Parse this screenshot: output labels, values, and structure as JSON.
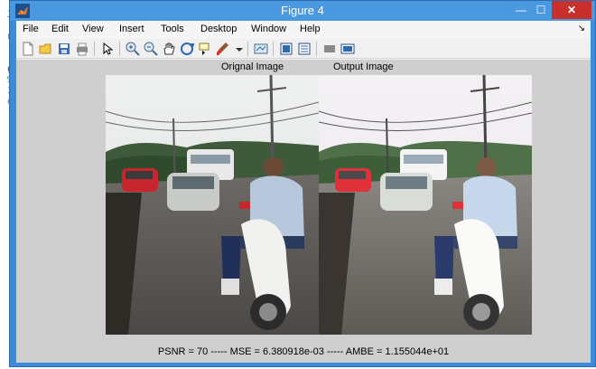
{
  "window": {
    "title": "Figure 4",
    "close_glyph": "✕",
    "minimize_glyph": "—",
    "maximize_glyph": "☐"
  },
  "menu": {
    "items": [
      "File",
      "Edit",
      "View",
      "Insert",
      "Tools",
      "Desktop",
      "Window",
      "Help"
    ],
    "dock_glyph": "↘"
  },
  "toolbar": {
    "icons": [
      "new-figure-icon",
      "open-file-icon",
      "save-icon",
      "print-icon",
      "edit-plot-icon",
      "zoom-in-icon",
      "zoom-out-icon",
      "pan-icon",
      "rotate-3d-icon",
      "data-cursor-icon",
      "brush-icon",
      "link-plot-icon",
      "insert-colorbar-icon",
      "insert-legend-icon",
      "hide-plot-tools-icon",
      "show-plot-tools-icon"
    ]
  },
  "figure": {
    "left_title": "Orignal Image",
    "right_title": "Output Image",
    "caption": "PSNR = 70 ----- MSE  = 6.380918e-03 ----- AMBE = 1.155044e+01"
  },
  "background_editor": {
    "lines": [
      "j",
      "r",
      "g",
      "%",
      "I",
      "c"
    ]
  },
  "colors": {
    "title_bar": "#4a98e0",
    "close_button": "#c9302c",
    "figure_background": "#cfcfcf"
  }
}
